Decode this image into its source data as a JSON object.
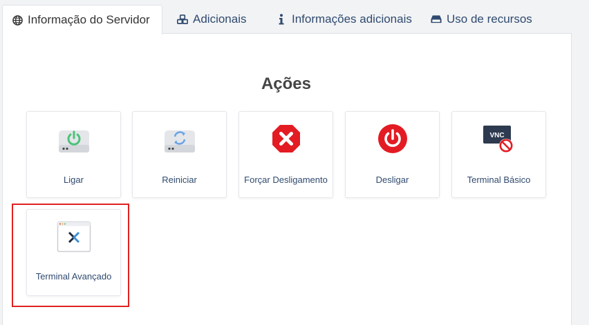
{
  "tabs": [
    {
      "label": "Informação do Servidor",
      "icon": "globe-icon",
      "active": true
    },
    {
      "label": "Adicionais",
      "icon": "cubes-icon",
      "active": false
    },
    {
      "label": "Informações adicionais",
      "icon": "info-icon",
      "active": false
    },
    {
      "label": "Uso de recursos",
      "icon": "inbox-icon",
      "active": false
    }
  ],
  "actions": {
    "title": "Ações",
    "items": [
      {
        "label": "Ligar",
        "icon": "power-on-drive-icon"
      },
      {
        "label": "Reiniciar",
        "icon": "restart-drive-icon"
      },
      {
        "label": "Forçar Desligamento",
        "icon": "force-stop-icon"
      },
      {
        "label": "Desligar",
        "icon": "power-off-icon"
      },
      {
        "label": "Terminal Básico",
        "icon": "vnc-terminal-icon"
      },
      {
        "label": "Terminal Avançado",
        "icon": "advanced-terminal-icon"
      }
    ]
  },
  "colors": {
    "link": "#2f4a6e",
    "highlight": "#e02020",
    "danger": "#e31b23",
    "power_green": "#4cc27a"
  }
}
